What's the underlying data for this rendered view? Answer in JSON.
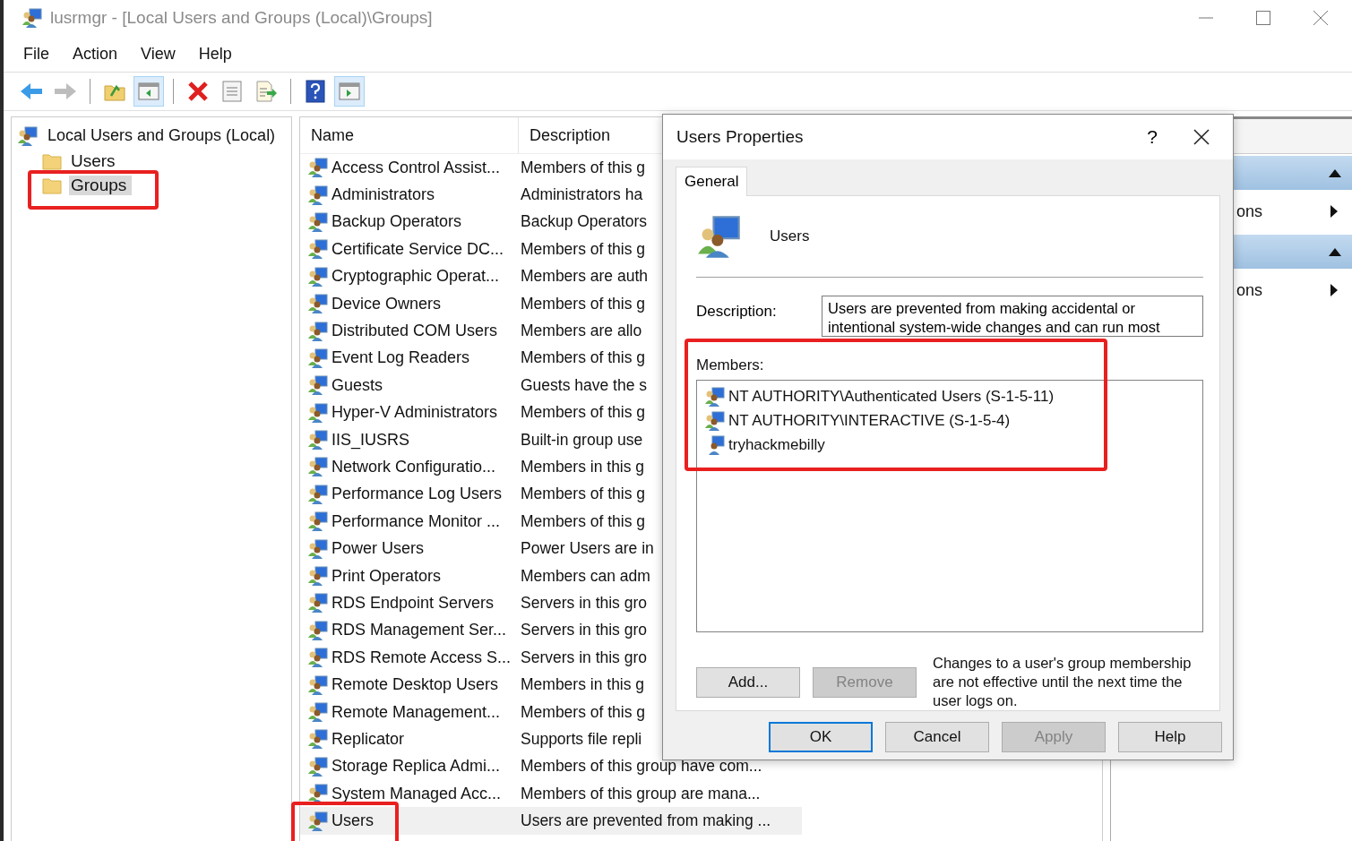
{
  "window": {
    "title": "lusrmgr - [Local Users and Groups (Local)\\Groups]"
  },
  "menu": [
    {
      "label": "File"
    },
    {
      "label": "Action"
    },
    {
      "label": "View"
    },
    {
      "label": "Help"
    }
  ],
  "toolbar": [
    {
      "kind": "back",
      "disabled": false,
      "pressed": false
    },
    {
      "kind": "forward",
      "disabled": true,
      "pressed": false
    },
    {
      "kind": "separator"
    },
    {
      "kind": "up",
      "disabled": false,
      "pressed": false
    },
    {
      "kind": "tree",
      "disabled": false,
      "pressed": true
    },
    {
      "kind": "separator"
    },
    {
      "kind": "delete",
      "disabled": false,
      "pressed": false
    },
    {
      "kind": "properties",
      "disabled": false,
      "pressed": false
    },
    {
      "kind": "export",
      "disabled": false,
      "pressed": false
    },
    {
      "kind": "separator"
    },
    {
      "kind": "help",
      "disabled": false,
      "pressed": false
    },
    {
      "kind": "actionpane",
      "disabled": false,
      "pressed": true
    }
  ],
  "tree": {
    "label": "Local Users and Groups (Local)",
    "children": [
      {
        "label": "Users",
        "selected": false,
        "highlighted": false
      },
      {
        "label": "Groups",
        "selected": true,
        "highlighted": true
      }
    ]
  },
  "list": {
    "columns": [
      "Name",
      "Description"
    ],
    "rows": [
      {
        "name": "Access Control Assist...",
        "description": "Members of this g",
        "selected": false,
        "highlighted": false
      },
      {
        "name": "Administrators",
        "description": "Administrators ha",
        "selected": false,
        "highlighted": false
      },
      {
        "name": "Backup Operators",
        "description": "Backup Operators",
        "selected": false,
        "highlighted": false
      },
      {
        "name": "Certificate Service DC...",
        "description": "Members of this g",
        "selected": false,
        "highlighted": false
      },
      {
        "name": "Cryptographic Operat...",
        "description": "Members are auth",
        "selected": false,
        "highlighted": false
      },
      {
        "name": "Device Owners",
        "description": "Members of this g",
        "selected": false,
        "highlighted": false
      },
      {
        "name": "Distributed COM Users",
        "description": "Members are allo",
        "selected": false,
        "highlighted": false
      },
      {
        "name": "Event Log Readers",
        "description": "Members of this g",
        "selected": false,
        "highlighted": false
      },
      {
        "name": "Guests",
        "description": "Guests have the s",
        "selected": false,
        "highlighted": false
      },
      {
        "name": "Hyper-V Administrators",
        "description": "Members of this g",
        "selected": false,
        "highlighted": false
      },
      {
        "name": "IIS_IUSRS",
        "description": "Built-in group use",
        "selected": false,
        "highlighted": false
      },
      {
        "name": "Network Configuratio...",
        "description": "Members in this g",
        "selected": false,
        "highlighted": false
      },
      {
        "name": "Performance Log Users",
        "description": "Members of this g",
        "selected": false,
        "highlighted": false
      },
      {
        "name": "Performance Monitor ...",
        "description": "Members of this g",
        "selected": false,
        "highlighted": false
      },
      {
        "name": "Power Users",
        "description": "Power Users are in",
        "selected": false,
        "highlighted": false
      },
      {
        "name": "Print Operators",
        "description": "Members can adm",
        "selected": false,
        "highlighted": false
      },
      {
        "name": "RDS Endpoint Servers",
        "description": "Servers in this gro",
        "selected": false,
        "highlighted": false
      },
      {
        "name": "RDS Management Ser...",
        "description": "Servers in this gro",
        "selected": false,
        "highlighted": false
      },
      {
        "name": "RDS Remote Access S...",
        "description": "Servers in this gro",
        "selected": false,
        "highlighted": false
      },
      {
        "name": "Remote Desktop Users",
        "description": "Members in this g",
        "selected": false,
        "highlighted": false
      },
      {
        "name": "Remote Management...",
        "description": "Members of this g",
        "selected": false,
        "highlighted": false
      },
      {
        "name": "Replicator",
        "description": "Supports file repli",
        "selected": false,
        "highlighted": false
      },
      {
        "name": "Storage Replica Admi...",
        "description": "Members of this group have com...",
        "selected": false,
        "highlighted": false
      },
      {
        "name": "System Managed Acc...",
        "description": "Members of this group are mana...",
        "selected": false,
        "highlighted": false
      },
      {
        "name": "Users",
        "description": "Users are prevented from making ...",
        "selected": true,
        "highlighted": true
      }
    ]
  },
  "actions": {
    "sections": [
      {
        "expanded": true,
        "items": [
          {
            "label": "ons"
          }
        ]
      },
      {
        "expanded": true,
        "items": [
          {
            "label": "ons"
          }
        ]
      }
    ]
  },
  "dialog": {
    "title": "Users Properties",
    "help_button": "?",
    "tabs": [
      {
        "label": "General",
        "selected": true
      }
    ],
    "object_name": "Users",
    "description_label": "Description:",
    "description": "Users are prevented from making accidental or intentional system-wide changes and can run most",
    "members_label": "Members:",
    "members_highlighted": true,
    "members": [
      {
        "name": "NT AUTHORITY\\Authenticated Users (S-1-5-11)",
        "kind": "group"
      },
      {
        "name": "NT AUTHORITY\\INTERACTIVE (S-1-5-4)",
        "kind": "group"
      },
      {
        "name": "tryhackmebilly",
        "kind": "user"
      }
    ],
    "member_buttons": [
      {
        "label": "Add...",
        "disabled": false
      },
      {
        "label": "Remove",
        "disabled": true
      }
    ],
    "note": "Changes to a user's group membership are not effective until the next time the user logs on.",
    "buttons": [
      {
        "label": "OK",
        "default": true,
        "disabled": false
      },
      {
        "label": "Cancel",
        "default": false,
        "disabled": false
      },
      {
        "label": "Apply",
        "default": false,
        "disabled": true
      },
      {
        "label": "Help",
        "default": false,
        "disabled": false
      }
    ]
  }
}
